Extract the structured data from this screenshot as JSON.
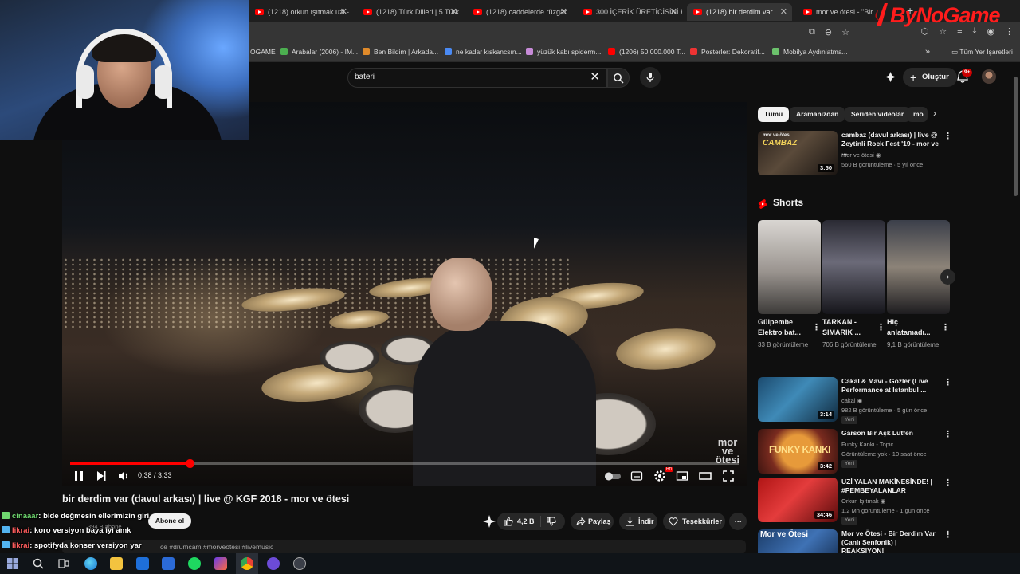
{
  "browser": {
    "tabs": [
      {
        "label": "(1218) orkun ışıtmak uzi -"
      },
      {
        "label": "(1218) Türk Dilleri | 5 Türk"
      },
      {
        "label": "(1218) caddelerde rüzgar"
      },
      {
        "label": "300 İÇERİK ÜRETİCİSİNİ K"
      },
      {
        "label": "(1218) bir derdim var"
      },
      {
        "label": "mor ve ötesi - \"Bir"
      }
    ],
    "bookmarks": [
      {
        "label": "OGAME"
      },
      {
        "label": "Arabalar (2006) - IM..."
      },
      {
        "label": "Ben Bildim | Arkada..."
      },
      {
        "label": "ne kadar kıskancsın..."
      },
      {
        "label": "yüzük kabı spiderm..."
      },
      {
        "label": "(1206) 50.000.000 T..."
      },
      {
        "label": "Posterler: Dekoratif..."
      },
      {
        "label": "Mobilya Aydınlatma..."
      }
    ],
    "all_bookmarks": "Tüm Yer İşaretleri"
  },
  "header": {
    "search_value": "bateri",
    "create_label": "Oluştur",
    "notification_count": "9+"
  },
  "player": {
    "time": "0:38 / 3:33",
    "progress": 0.1784,
    "watermark": "mor ve ötesi"
  },
  "video": {
    "title": "bir derdim var (davul arkası) | live @ KGF 2018 - mor ve ötesi",
    "subscribers_ghost": "394 B abone",
    "subscribe_label": "Abone ol",
    "like_count": "4,2 B",
    "share_label": "Paylaş",
    "download_label": "İndir",
    "thanks_label": "Teşekkürler",
    "desc_hashtags": "#drumcam #morveötesi #livemusic",
    "desc_prefix": "ce"
  },
  "chat": [
    {
      "user": "cinaaar",
      "message": ": bide değmesin ellerimizin giri"
    },
    {
      "user": "likrai",
      "message": ": koro versiyon baya iyi amk"
    },
    {
      "user": "likrai",
      "message": ": spotifyda konser versiyon yar"
    }
  ],
  "filters": [
    "Tümü",
    "Aramanızdan",
    "Seriden videolar",
    "mo"
  ],
  "recommendations_top": [
    {
      "title": "cambaz (davul arkası) | live @ Zeytinli Rock Fest '19 - mor ve ...",
      "channel": "mor ve ötesi",
      "meta": "560 B görüntüleme · 5 yıl önce",
      "duration": "3:50"
    }
  ],
  "shorts": {
    "heading": "Shorts",
    "items": [
      {
        "title": "Gülpembe Elektro bat...",
        "views": "33 B görüntüleme"
      },
      {
        "title": "TARKAN - SIMARIK ...",
        "views": "706 B görüntüleme"
      },
      {
        "title": "Hiç anlatamadı...",
        "views": "9,1 B görüntüleme"
      }
    ]
  },
  "recommendations": [
    {
      "title": "Cakal & Mavi - Gözler (Live Performance at İstanbul ...",
      "channel": "cakal",
      "meta": "982 B görüntüleme · 5 gün önce",
      "duration": "3:14",
      "badge": "Yeni"
    },
    {
      "title": "Garson Bir Aşk Lütfen",
      "channel": "Funky Kanki - Topic",
      "meta": "Görüntüleme yok · 10 saat önce",
      "duration": "3:42",
      "badge": "Yeni",
      "thumb_text": "FUNKY KANKI"
    },
    {
      "title": "UZİ YALAN MAKİNESİNDE! | #PEMBEYALANLAR",
      "channel": "Orkun Işıtmak",
      "meta": "1,2 Mn görüntüleme · 1 gün önce",
      "duration": "34:46",
      "badge": "Yeni"
    },
    {
      "title": "Mor ve Ötesi - Bir Derdim Var (Canlı Senfonik) | REAKSİYON!",
      "channel": "",
      "meta": "",
      "duration": "",
      "badge": "",
      "thumb_text": "Mor ve Ötesi"
    }
  ],
  "logo_text": "ByNoGame",
  "colors": {
    "accent": "#ff0000",
    "background": "#0f0f0f",
    "chip": "#272727"
  }
}
